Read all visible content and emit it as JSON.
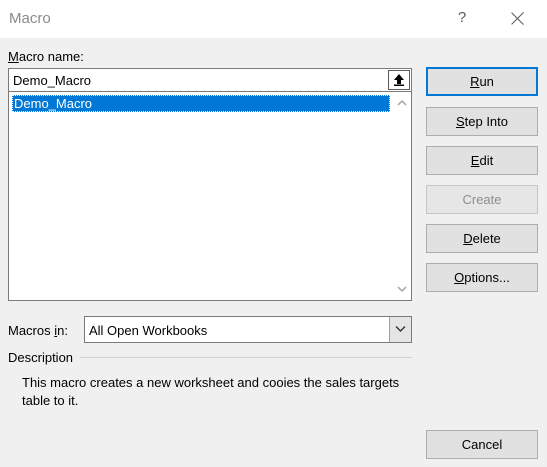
{
  "window": {
    "title": "Macro",
    "help_label": "?"
  },
  "macro_name": {
    "label_accel": "M",
    "label_rest": "acro name:",
    "value": "Demo_Macro"
  },
  "macro_list": {
    "items": [
      "Demo_Macro"
    ],
    "selected_index": 0
  },
  "macros_in": {
    "label_pre": "Macros ",
    "label_accel": "i",
    "label_rest": "n:",
    "selected": "All Open Workbooks"
  },
  "description": {
    "label": "Description",
    "text": "This macro creates a new worksheet and cooies the sales targets table to it."
  },
  "buttons": {
    "run": {
      "accel": "R",
      "rest": "un"
    },
    "step_into": {
      "accel": "S",
      "rest": "tep Into"
    },
    "edit": {
      "accel": "E",
      "rest": "dit"
    },
    "create": {
      "label": "Create"
    },
    "delete": {
      "accel": "D",
      "rest": "elete"
    },
    "options": {
      "accel": "O",
      "rest": "ptions..."
    },
    "cancel": {
      "label": "Cancel"
    }
  },
  "icons": {
    "help": "help-icon",
    "close": "close-icon",
    "collapse": "upload-arrow-icon",
    "scroll_up": "chevron-up-icon",
    "scroll_down": "chevron-down-icon",
    "dropdown": "chevron-down-icon"
  },
  "colors": {
    "accent": "#0078d7",
    "button_bg": "#e1e1e1",
    "dialog_bg": "#f0f0f0",
    "disabled_text": "#8d8d8d"
  }
}
